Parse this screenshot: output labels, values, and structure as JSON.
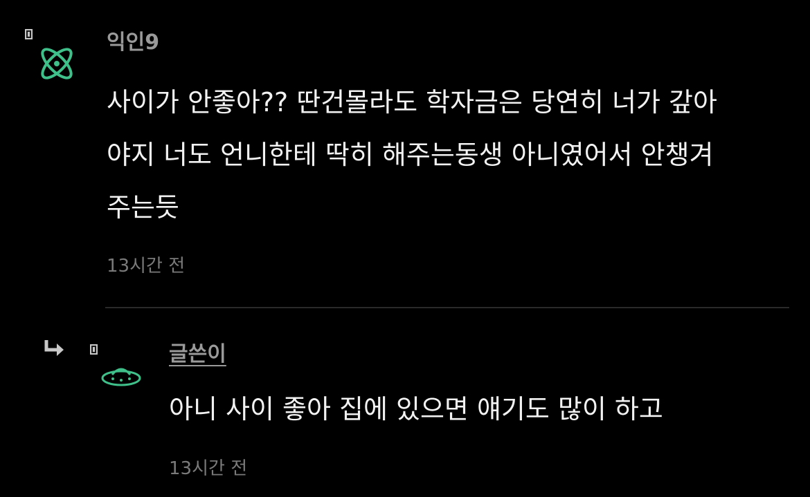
{
  "comments": [
    {
      "author": "익인9",
      "lines": [
        "사이가 안좋아?? 딴건몰라도 학자금은 당연히 너가 갚아",
        "야지 너도 언니한테 딱히 해주는동생 아니였어서 안챙겨",
        "주는듯"
      ],
      "time": "13시간 전",
      "avatar_icon": "atom-icon"
    },
    {
      "author": "글쓴이",
      "is_reply": true,
      "lines": [
        "아니 사이 좋아 집에 있으면 얘기도 많이 하고"
      ],
      "time": "13시간 전",
      "avatar_icon": "ufo-icon"
    }
  ],
  "colors": {
    "background": "#000000",
    "avatar_green": "#3fbf8a",
    "nickname": "#9a9a9a",
    "timestamp": "#7a7a7a"
  }
}
